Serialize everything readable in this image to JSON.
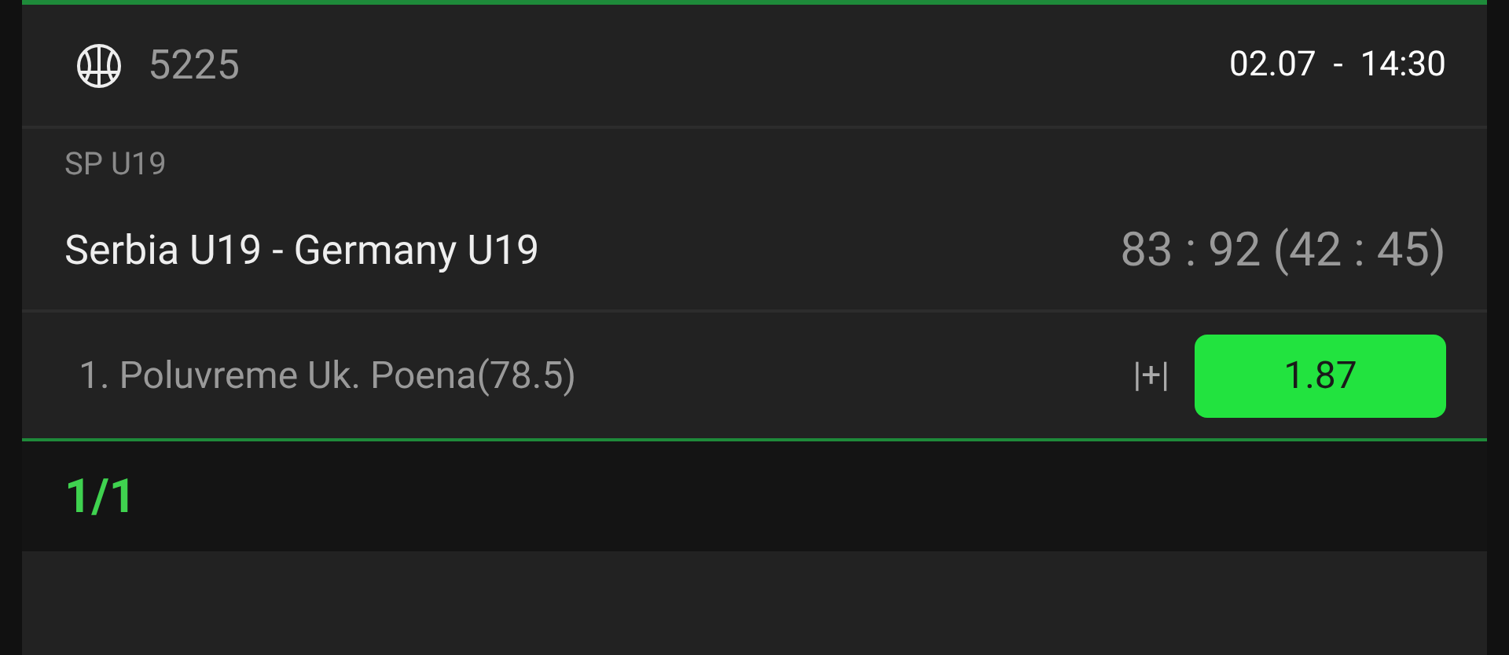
{
  "event": {
    "code": "5225",
    "datetime": "02.07  -  14:30",
    "league": "SP U19",
    "match": "Serbia U19 - Germany U19",
    "score": "83 : 92 (42 : 45)"
  },
  "bet": {
    "market": "1. Poluvreme Uk. Poena(78.5)",
    "sign": "|+|",
    "odds": "1.87",
    "selected": true
  },
  "pager": "1/1"
}
